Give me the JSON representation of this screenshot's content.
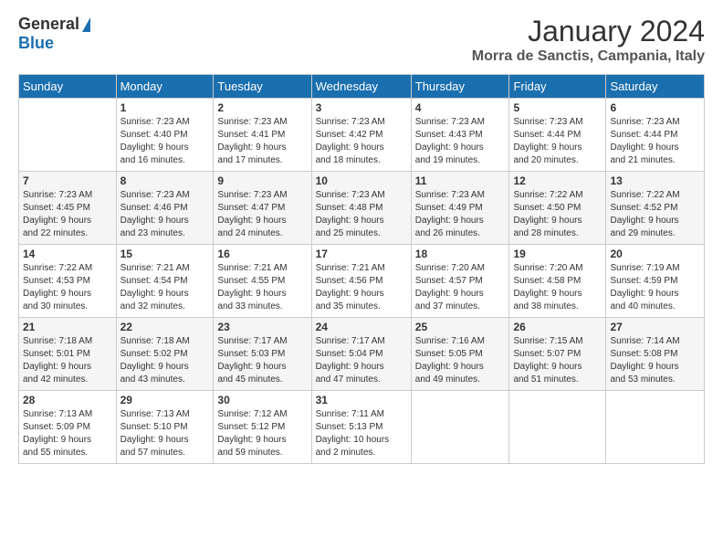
{
  "header": {
    "logo_general": "General",
    "logo_blue": "Blue",
    "title": "January 2024",
    "subtitle": "Morra de Sanctis, Campania, Italy"
  },
  "calendar": {
    "days_of_week": [
      "Sunday",
      "Monday",
      "Tuesday",
      "Wednesday",
      "Thursday",
      "Friday",
      "Saturday"
    ],
    "weeks": [
      [
        {
          "day": "",
          "info": ""
        },
        {
          "day": "1",
          "info": "Sunrise: 7:23 AM\nSunset: 4:40 PM\nDaylight: 9 hours\nand 16 minutes."
        },
        {
          "day": "2",
          "info": "Sunrise: 7:23 AM\nSunset: 4:41 PM\nDaylight: 9 hours\nand 17 minutes."
        },
        {
          "day": "3",
          "info": "Sunrise: 7:23 AM\nSunset: 4:42 PM\nDaylight: 9 hours\nand 18 minutes."
        },
        {
          "day": "4",
          "info": "Sunrise: 7:23 AM\nSunset: 4:43 PM\nDaylight: 9 hours\nand 19 minutes."
        },
        {
          "day": "5",
          "info": "Sunrise: 7:23 AM\nSunset: 4:44 PM\nDaylight: 9 hours\nand 20 minutes."
        },
        {
          "day": "6",
          "info": "Sunrise: 7:23 AM\nSunset: 4:44 PM\nDaylight: 9 hours\nand 21 minutes."
        }
      ],
      [
        {
          "day": "7",
          "info": "Sunrise: 7:23 AM\nSunset: 4:45 PM\nDaylight: 9 hours\nand 22 minutes."
        },
        {
          "day": "8",
          "info": "Sunrise: 7:23 AM\nSunset: 4:46 PM\nDaylight: 9 hours\nand 23 minutes."
        },
        {
          "day": "9",
          "info": "Sunrise: 7:23 AM\nSunset: 4:47 PM\nDaylight: 9 hours\nand 24 minutes."
        },
        {
          "day": "10",
          "info": "Sunrise: 7:23 AM\nSunset: 4:48 PM\nDaylight: 9 hours\nand 25 minutes."
        },
        {
          "day": "11",
          "info": "Sunrise: 7:23 AM\nSunset: 4:49 PM\nDaylight: 9 hours\nand 26 minutes."
        },
        {
          "day": "12",
          "info": "Sunrise: 7:22 AM\nSunset: 4:50 PM\nDaylight: 9 hours\nand 28 minutes."
        },
        {
          "day": "13",
          "info": "Sunrise: 7:22 AM\nSunset: 4:52 PM\nDaylight: 9 hours\nand 29 minutes."
        }
      ],
      [
        {
          "day": "14",
          "info": "Sunrise: 7:22 AM\nSunset: 4:53 PM\nDaylight: 9 hours\nand 30 minutes."
        },
        {
          "day": "15",
          "info": "Sunrise: 7:21 AM\nSunset: 4:54 PM\nDaylight: 9 hours\nand 32 minutes."
        },
        {
          "day": "16",
          "info": "Sunrise: 7:21 AM\nSunset: 4:55 PM\nDaylight: 9 hours\nand 33 minutes."
        },
        {
          "day": "17",
          "info": "Sunrise: 7:21 AM\nSunset: 4:56 PM\nDaylight: 9 hours\nand 35 minutes."
        },
        {
          "day": "18",
          "info": "Sunrise: 7:20 AM\nSunset: 4:57 PM\nDaylight: 9 hours\nand 37 minutes."
        },
        {
          "day": "19",
          "info": "Sunrise: 7:20 AM\nSunset: 4:58 PM\nDaylight: 9 hours\nand 38 minutes."
        },
        {
          "day": "20",
          "info": "Sunrise: 7:19 AM\nSunset: 4:59 PM\nDaylight: 9 hours\nand 40 minutes."
        }
      ],
      [
        {
          "day": "21",
          "info": "Sunrise: 7:18 AM\nSunset: 5:01 PM\nDaylight: 9 hours\nand 42 minutes."
        },
        {
          "day": "22",
          "info": "Sunrise: 7:18 AM\nSunset: 5:02 PM\nDaylight: 9 hours\nand 43 minutes."
        },
        {
          "day": "23",
          "info": "Sunrise: 7:17 AM\nSunset: 5:03 PM\nDaylight: 9 hours\nand 45 minutes."
        },
        {
          "day": "24",
          "info": "Sunrise: 7:17 AM\nSunset: 5:04 PM\nDaylight: 9 hours\nand 47 minutes."
        },
        {
          "day": "25",
          "info": "Sunrise: 7:16 AM\nSunset: 5:05 PM\nDaylight: 9 hours\nand 49 minutes."
        },
        {
          "day": "26",
          "info": "Sunrise: 7:15 AM\nSunset: 5:07 PM\nDaylight: 9 hours\nand 51 minutes."
        },
        {
          "day": "27",
          "info": "Sunrise: 7:14 AM\nSunset: 5:08 PM\nDaylight: 9 hours\nand 53 minutes."
        }
      ],
      [
        {
          "day": "28",
          "info": "Sunrise: 7:13 AM\nSunset: 5:09 PM\nDaylight: 9 hours\nand 55 minutes."
        },
        {
          "day": "29",
          "info": "Sunrise: 7:13 AM\nSunset: 5:10 PM\nDaylight: 9 hours\nand 57 minutes."
        },
        {
          "day": "30",
          "info": "Sunrise: 7:12 AM\nSunset: 5:12 PM\nDaylight: 9 hours\nand 59 minutes."
        },
        {
          "day": "31",
          "info": "Sunrise: 7:11 AM\nSunset: 5:13 PM\nDaylight: 10 hours\nand 2 minutes."
        },
        {
          "day": "",
          "info": ""
        },
        {
          "day": "",
          "info": ""
        },
        {
          "day": "",
          "info": ""
        }
      ]
    ]
  }
}
